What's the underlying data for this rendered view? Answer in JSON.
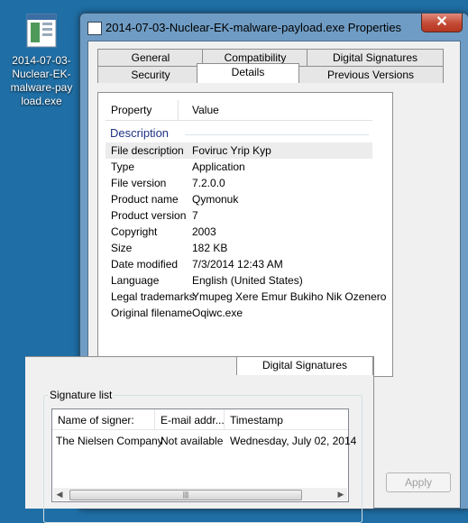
{
  "desktop": {
    "icon_label_lines": [
      "2014-07-03-",
      "Nuclear-EK-",
      "malware-pay",
      "load.exe"
    ],
    "icon_name": "executable-file-icon"
  },
  "window": {
    "title": "2014-07-03-Nuclear-EK-malware-payload.exe Properties",
    "close_label": "✕",
    "tabs_row1": [
      "General",
      "Compatibility",
      "Digital Signatures"
    ],
    "tabs_row2": [
      "Security",
      "Details",
      "Previous Versions"
    ],
    "active_tab": "Details"
  },
  "details": {
    "columns": [
      "Property",
      "Value"
    ],
    "group": "Description",
    "rows": [
      {
        "k": "File description",
        "v": "Foviruc Yrip Kyp"
      },
      {
        "k": "Type",
        "v": "Application"
      },
      {
        "k": "File version",
        "v": "7.2.0.0"
      },
      {
        "k": "Product name",
        "v": "Qymonuk"
      },
      {
        "k": "Product version",
        "v": "7"
      },
      {
        "k": "Copyright",
        "v": "2003"
      },
      {
        "k": "Size",
        "v": "182 KB"
      },
      {
        "k": "Date modified",
        "v": "7/3/2014 12:43 AM"
      },
      {
        "k": "Language",
        "v": "English (United States)"
      },
      {
        "k": "Legal trademarks",
        "v": "Ymupeg Xere Emur Bukiho Nik Ozenero"
      },
      {
        "k": "Original filename",
        "v": "Oqiwc.exe"
      }
    ]
  },
  "buttons": {
    "apply": "Apply"
  },
  "signatures": {
    "tab": "Digital Signatures",
    "group_label": "Signature list",
    "columns": [
      "Name of signer:",
      "E-mail addr...",
      "Timestamp"
    ],
    "rows": [
      {
        "name": "The Nielsen Company",
        "email": "Not available",
        "timestamp": "Wednesday, July 02, 2014"
      }
    ],
    "scroll_left": "◀",
    "scroll_right": "▶",
    "scroll_grip": "|||"
  },
  "colors": {
    "desktop": "#1f6fa6",
    "window_frame": "#6f9cc4",
    "close": "#c44a35",
    "group_text": "#1e3287"
  }
}
